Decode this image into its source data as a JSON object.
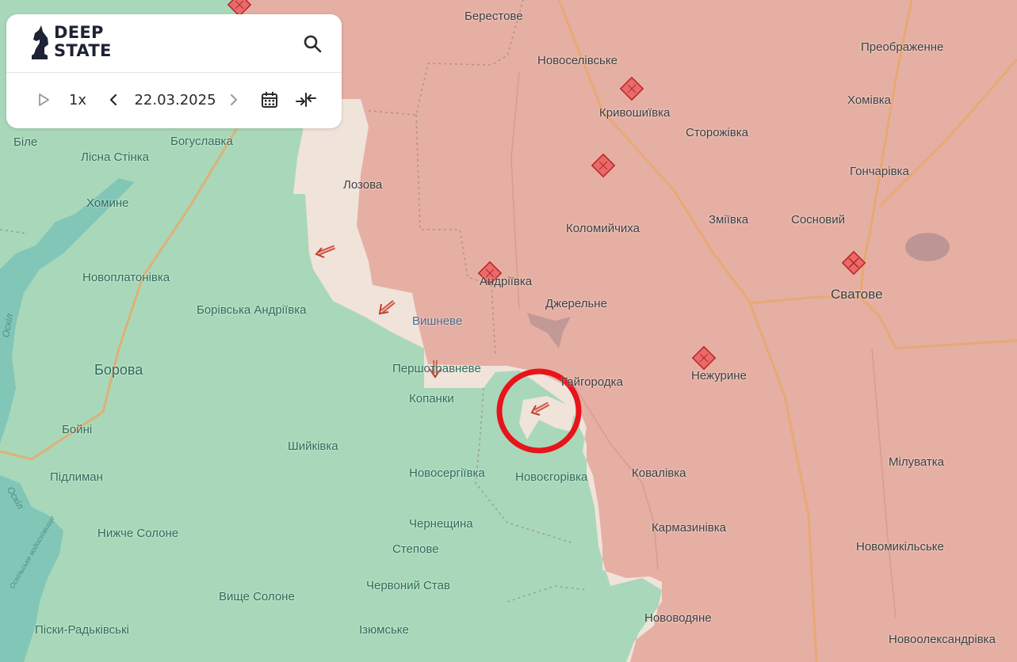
{
  "app": {
    "logo_line1": "DEEP",
    "logo_line2": "STATE"
  },
  "toolbar": {
    "speed_label": "1x",
    "date_value": "22.03.2025",
    "icons": [
      "play-icon",
      "chevron-left-icon",
      "chevron-right-icon",
      "calendar-icon",
      "compare-arrows-icon",
      "search-icon"
    ]
  },
  "map": {
    "colors": {
      "occupied": "#e6afa3",
      "liberated": "#a8d8b9",
      "contested": "#efe3da",
      "water": "#7bc3b7",
      "highlight_circle": "#e8131b"
    },
    "labels": {
      "berestove": "Берестове",
      "novoselivske": "Новоселівське",
      "preobrazhenne": "Преображенне",
      "kryvoshyivka": "Кривошиївка",
      "khomivka": "Хомівка",
      "storozhivka": "Сторожівка",
      "bile": "Біле",
      "bohuslavka": "Богуславка",
      "lisna_stinka": "Лісна Стінка",
      "lozova": "Лозова",
      "honcharivka": "Гончарівка",
      "khomyne": "Хомине",
      "kolomyichykha": "Коломийчиха",
      "zmiivka": "Зміївка",
      "sosnovyi": "Сосновий",
      "novoplatonivka": "Новоплатонівка",
      "andriivka": "Андріївка",
      "svatove": "Сватове",
      "dzherelne": "Джерельне",
      "borivska_andriivka": "Борівська Андріївка",
      "vyshneve": "Вишневе",
      "borova": "Борова",
      "pershotravneve": "Першотравневе",
      "haihorodka": "Гайгородка",
      "nezhuryne": "Нежурине",
      "kopanky": "Копанки",
      "boini": "Бойні",
      "shyikivka": "Шийківка",
      "miluvatka": "Мілуватка",
      "pidlyman": "Підлиман",
      "novoserhiivka": "Новосергіївка",
      "novoiehorivka": "Новоєгорівка",
      "kovalivka": "Ковалівка",
      "chernechshyna": "Чернещина",
      "karmazynivka": "Кармазинівка",
      "nyzhche_solone": "Нижче Солоне",
      "stepove": "Степове",
      "novomykilske": "Новомикільське",
      "chervonyi_stav": "Червоний Став",
      "vyshche_solone": "Вище Солоне",
      "novovodiane": "Нововодяне",
      "pisky_radkivski": "Піски-Радьківські",
      "iziumske": "Ізюмське",
      "novooleksandrivka": "Новоолександрівка",
      "river_oskil_1": "Оскіл",
      "river_oskil_2": "Оскіл",
      "reservoir": "Оскільське водосховище"
    }
  }
}
